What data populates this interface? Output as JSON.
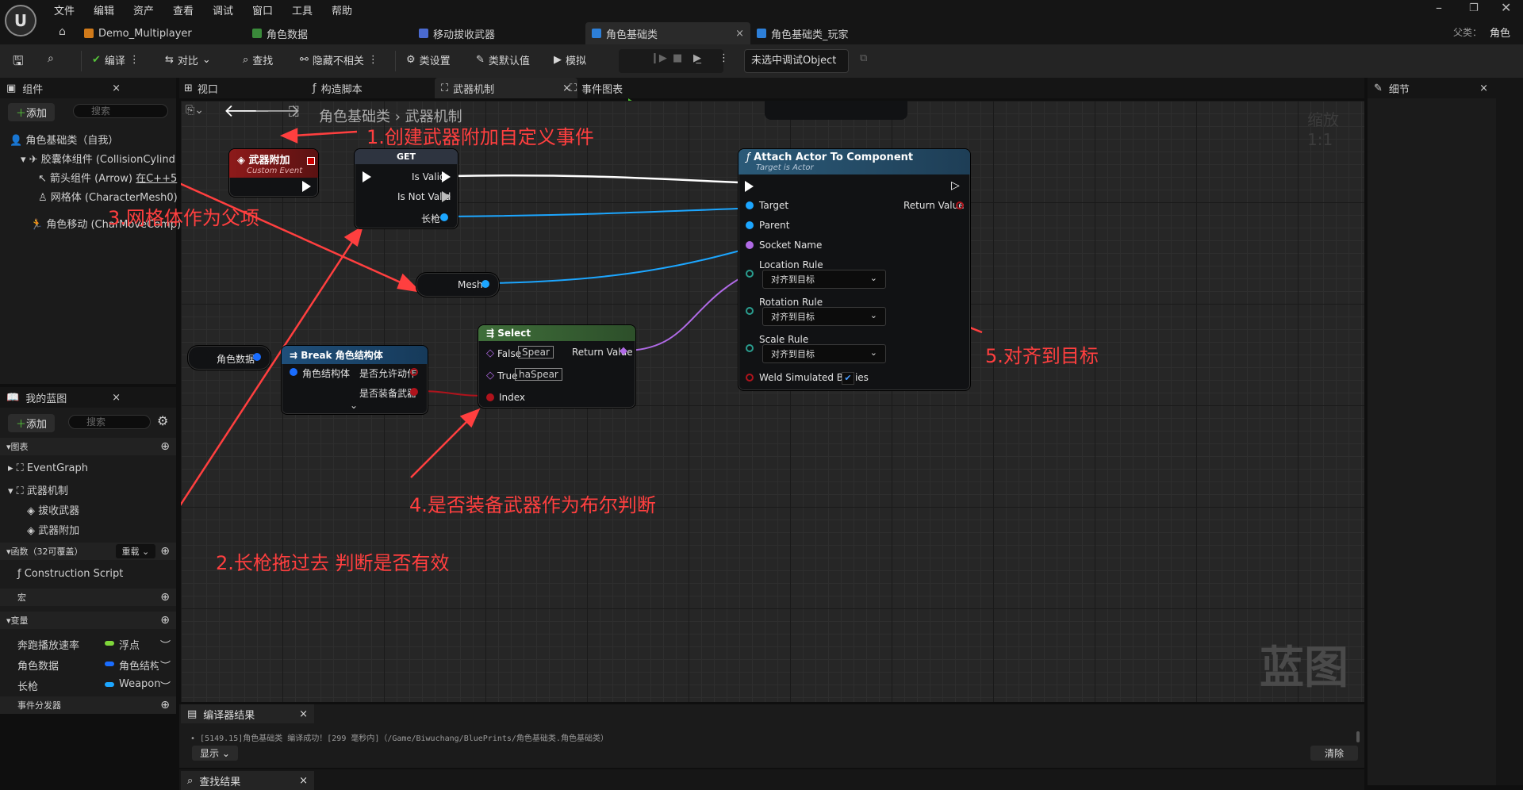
{
  "menu": [
    "文件",
    "编辑",
    "资产",
    "查看",
    "调试",
    "窗口",
    "工具",
    "帮助"
  ],
  "tabs": [
    {
      "label": "Demo_Multiplayer"
    },
    {
      "label": "角色数据"
    },
    {
      "label": "移动拔收武器"
    },
    {
      "label": "角色基础类",
      "close": "×"
    },
    {
      "label": "角色基础类_玩家"
    }
  ],
  "parent": {
    "label": "父类：",
    "value": "角色"
  },
  "toolbar": {
    "compile": "编译",
    "diff": "对比",
    "find": "查找",
    "hide": "隐藏不相关",
    "class_settings": "类设置",
    "class_defaults": "类默认值",
    "simulate": "模拟",
    "debug_select": "未选中调试Object"
  },
  "components": {
    "title": "组件",
    "add": "添加",
    "search_placeholder": "搜索",
    "items": [
      "角色基础类（自我）",
      "胶囊体组件 (CollisionCylind",
      "箭头组件 (Arrow)",
      "网格体 (CharacterMesh0)",
      "角色移动 (CharMoveComp)"
    ],
    "arrow_link": "在C++5"
  },
  "my_blueprint": {
    "title": "我的蓝图",
    "add": "添加",
    "search_placeholder": "搜索",
    "graphs_label": "图表",
    "event_graph": "EventGraph",
    "weapon_graph": "武器机制",
    "events": [
      "拔收武器",
      "武器附加"
    ],
    "functions_label": "函数（32可覆盖）",
    "override": "重载",
    "construction": "Construction Script",
    "macros_label": "宏",
    "variables_label": "变量",
    "variables": [
      {
        "name": "奔跑播放速率",
        "type": "浮点",
        "color": "#7fd63a"
      },
      {
        "name": "角色数据",
        "type": "角色结构",
        "color": "#1a6dff"
      },
      {
        "name": "长枪",
        "type": "Weapon",
        "color": "#1ca6ff"
      }
    ],
    "dispatchers_label": "事件分发器"
  },
  "graph_tabs": [
    "视口",
    "构造脚本",
    "武器机制",
    "事件图表"
  ],
  "breadcrumb": {
    "root": "角色基础类",
    "current": "武器机制"
  },
  "zoom": "缩放1:1",
  "watermark": "蓝图",
  "nodes": {
    "event": {
      "title": "武器附加",
      "subtitle": "Custom Event"
    },
    "get": {
      "title": "GET",
      "is_valid": "Is Valid",
      "is_not_valid": "Is Not Valid",
      "weapon": "长枪"
    },
    "mesh": {
      "label": "Mesh"
    },
    "attach": {
      "title": "Attach Actor To Component",
      "subtitle": "Target is Actor",
      "target": "Target",
      "parent": "Parent",
      "socket": "Socket Name",
      "return": "Return Value",
      "location_rule": "Location Rule",
      "rotation_rule": "Rotation Rule",
      "scale_rule": "Scale Rule",
      "rule_value": "对齐到目标",
      "weld": "Weld Simulated Bodies"
    },
    "char_data": {
      "label": "角色数据"
    },
    "break": {
      "title": "Break 角色结构体",
      "input": "角色结构体",
      "out1": "是否允许动作",
      "out2": "是否装备武器"
    },
    "select": {
      "title": "Select",
      "false_label": "False",
      "false_val": "Spear",
      "true_label": "True",
      "true_val": "haSpear",
      "index": "Index",
      "return": "Return Value"
    }
  },
  "annotations": [
    "1.创建武器附加自定义事件",
    "2.长枪拖过去 判断是否有效",
    "3.网格体作为父项",
    "4.是否装备武器作为布尔判断",
    "5.对齐到目标"
  ],
  "details": {
    "title": "细节"
  },
  "compiler": {
    "title": "编译器结果",
    "message": "[5149.15]角色基础类 编译成功！[299 毫秒内]（/Game/Biwuchang/BluePrints/角色基础类.角色基础类）",
    "show": "显示",
    "clear": "清除"
  },
  "find_results": {
    "title": "查找结果"
  }
}
